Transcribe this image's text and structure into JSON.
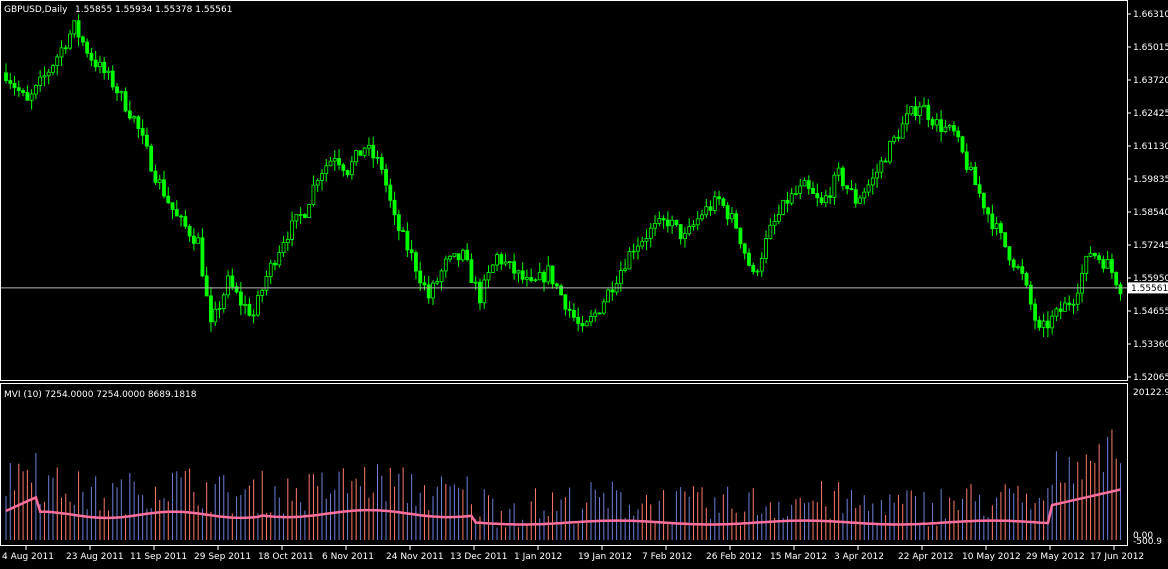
{
  "chart_data": [
    {
      "type": "candlestick",
      "symbol_title": "GBPUSD,Daily",
      "ohlc_readout": "1.55855 1.55934 1.55378 1.55561",
      "ylim": [
        1.52065,
        1.6631
      ],
      "y_ticks": [
        "1.66310",
        "1.65015",
        "1.63720",
        "1.62425",
        "1.61130",
        "1.59835",
        "1.58540",
        "1.57245",
        "1.55950",
        "1.54655",
        "1.53360",
        "1.52065"
      ],
      "current_price": "1.55561",
      "x_ticks": [
        "4 Aug 2011",
        "23 Aug 2011",
        "11 Sep 2011",
        "29 Sep 2011",
        "18 Oct 2011",
        "6 Nov 2011",
        "24 Nov 2011",
        "13 Dec 2011",
        "1 Jan 2012",
        "19 Jan 2012",
        "7 Feb 2012",
        "26 Feb 2012",
        "15 Mar 2012",
        "3 Apr 2012",
        "22 Apr 2012",
        "10 May 2012",
        "29 May 2012",
        "17 Jun 2012"
      ],
      "close_path_anchors": [
        [
          0,
          1.64
        ],
        [
          5,
          1.628
        ],
        [
          10,
          1.641
        ],
        [
          16,
          1.658
        ],
        [
          20,
          1.646
        ],
        [
          25,
          1.636
        ],
        [
          30,
          1.622
        ],
        [
          35,
          1.6
        ],
        [
          40,
          1.583
        ],
        [
          45,
          1.574
        ],
        [
          48,
          1.54
        ],
        [
          52,
          1.558
        ],
        [
          55,
          1.55
        ],
        [
          58,
          1.545
        ],
        [
          61,
          1.56
        ],
        [
          65,
          1.575
        ],
        [
          70,
          1.586
        ],
        [
          73,
          1.6
        ],
        [
          77,
          1.608
        ],
        [
          80,
          1.602
        ],
        [
          84,
          1.611
        ],
        [
          88,
          1.603
        ],
        [
          91,
          1.582
        ],
        [
          95,
          1.568
        ],
        [
          99,
          1.552
        ],
        [
          103,
          1.565
        ],
        [
          107,
          1.568
        ],
        [
          111,
          1.552
        ],
        [
          115,
          1.568
        ],
        [
          119,
          1.562
        ],
        [
          123,
          1.556
        ],
        [
          127,
          1.562
        ],
        [
          131,
          1.55
        ],
        [
          135,
          1.538
        ],
        [
          139,
          1.548
        ],
        [
          143,
          1.56
        ],
        [
          147,
          1.572
        ],
        [
          151,
          1.578
        ],
        [
          155,
          1.582
        ],
        [
          159,
          1.575
        ],
        [
          163,
          1.585
        ],
        [
          167,
          1.59
        ],
        [
          171,
          1.58
        ],
        [
          175,
          1.56
        ],
        [
          179,
          1.578
        ],
        [
          183,
          1.59
        ],
        [
          187,
          1.595
        ],
        [
          191,
          1.588
        ],
        [
          195,
          1.6
        ],
        [
          199,
          1.59
        ],
        [
          203,
          1.598
        ],
        [
          207,
          1.611
        ],
        [
          211,
          1.622
        ],
        [
          214,
          1.628
        ],
        [
          218,
          1.62
        ],
        [
          222,
          1.616
        ],
        [
          226,
          1.6
        ],
        [
          230,
          1.585
        ],
        [
          234,
          1.572
        ],
        [
          238,
          1.56
        ],
        [
          242,
          1.538
        ],
        [
          246,
          1.545
        ],
        [
          250,
          1.552
        ],
        [
          254,
          1.57
        ],
        [
          258,
          1.565
        ],
        [
          261,
          1.556
        ]
      ],
      "series": [
        {
          "name": "",
          "values": []
        }
      ]
    },
    {
      "type": "bar",
      "indicator_title": "MVI (10) 7254.0000 7254.0000 8689.1818",
      "ylim": [
        0,
        20122.9
      ],
      "y_ticks": [
        "20122.9",
        "0.00",
        "-500.9"
      ],
      "series": [
        {
          "name": "",
          "values": []
        }
      ]
    }
  ],
  "colors": {
    "background": "#000000",
    "bull_candle": "#00ff00",
    "grid_frame": "#ffffff",
    "mvi_bar_up": "#6d7fd8",
    "mvi_bar_down": "#ff7a6a",
    "mvi_line": "#ff6f9e"
  }
}
